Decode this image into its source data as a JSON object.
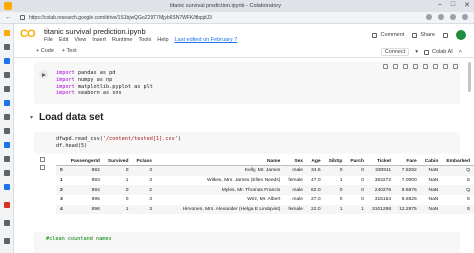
{
  "window": {
    "title": "titanic survival prediction.ipynb - Colaboratory"
  },
  "browser": {
    "url": "https://colab.research.google.com/drive/1S1bjwQGoZ29T7Mjyb6SN7WFK/ltbpjdJ3"
  },
  "notebook": {
    "logo": "CO",
    "title": "titanic survival prediction.ipynb",
    "menu": [
      "File",
      "Edit",
      "View",
      "Insert",
      "Runtime",
      "Tools",
      "Help"
    ],
    "last_edited": "Last edited on February 7",
    "comment_label": "Comment",
    "share_label": "Share",
    "ai_label": "Colab AI"
  },
  "toolbar": {
    "add_code": "+ Code",
    "add_text": "+ Text",
    "connect": "Connect"
  },
  "cells": {
    "imports": {
      "line1_kw": "import",
      "line1_rest": " pandas as pd",
      "line2_kw": "import",
      "line2_rest": " numpy as np",
      "line3_kw": "import",
      "line3_rest": " matplotlib.pyplot as plt",
      "line4_kw": "import",
      "line4_rest": " seaborn as sns"
    },
    "section_title": "Load data set",
    "read": {
      "exec_count": "[ ]",
      "line1_pre": "dfwpd.read_csv(",
      "line1_str": "'/content/tested[1].csv'",
      "line1_post": ")",
      "line2": "df.head(5)"
    },
    "last": {
      "line1": "#clean countand names"
    }
  },
  "dataframe": {
    "columns": [
      "",
      "PassengerId",
      "Survived",
      "Pclass",
      "Name",
      "Sex",
      "Age",
      "SibSp",
      "Parch",
      "Ticket",
      "Fare",
      "Cabin",
      "Embarked"
    ],
    "rows": [
      [
        "0",
        "892",
        "0",
        "3",
        "Kelly, Mr. James",
        "male",
        "34.5",
        "0",
        "0",
        "330911",
        "7.8292",
        "NaN",
        "Q"
      ],
      [
        "1",
        "893",
        "1",
        "3",
        "Wilkes, Mrs. James (Ellen Needs)",
        "female",
        "47.0",
        "1",
        "0",
        "363272",
        "7.0000",
        "NaN",
        "S"
      ],
      [
        "2",
        "894",
        "0",
        "2",
        "Myles, Mr. Thomas Francis",
        "male",
        "62.0",
        "0",
        "0",
        "240276",
        "9.6875",
        "NaN",
        "Q"
      ],
      [
        "3",
        "895",
        "0",
        "3",
        "Wirz, Mr. Albert",
        "male",
        "27.0",
        "0",
        "0",
        "315154",
        "8.6625",
        "NaN",
        "S"
      ],
      [
        "4",
        "896",
        "1",
        "3",
        "Hirvonen, Mrs. Alexander (Helga E Lindqvist)",
        "female",
        "22.0",
        "1",
        "1",
        "3101298",
        "12.2875",
        "NaN",
        "S"
      ]
    ]
  },
  "colors": {
    "accent": "#1a73e8",
    "logo_orange": "#f9ab00",
    "code_bg": "#f7f7f7",
    "keyword": "#af00db",
    "string": "#a31515"
  }
}
